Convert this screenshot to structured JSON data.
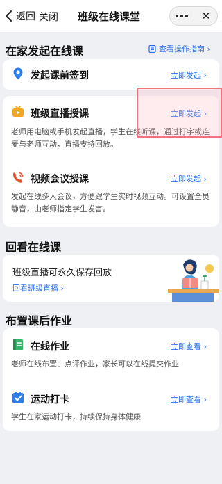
{
  "navbar": {
    "back_label": "返回",
    "close_label": "关闭",
    "title": "班级在线课堂",
    "more_icon": "more-dots-icon",
    "close_icon": "close-x-icon"
  },
  "section_start": {
    "title": "在家发起在线课",
    "guide_link": "查看操作指南 ›",
    "guide_icon": "document-icon",
    "items": [
      {
        "title": "发起课前签到",
        "action": "立即发起 ›",
        "icon": "location-pin-icon",
        "icon_color": "#2e7fe8"
      },
      {
        "title": "班级直播授课",
        "action": "立即发起 ›",
        "icon": "live-tv-icon",
        "icon_color": "#f4a623",
        "desc": "老师用电脑或手机发起直播，学生在线听课，通过打字或连麦与老师互动，直播支持回放。"
      },
      {
        "title": "视频会议授课",
        "action": "立即发起 ›",
        "icon": "video-call-icon",
        "icon_color": "#e8542e",
        "desc": "发起在线多人会议，方便跟学生实时视频互动。可设置全员静音，由老师指定学生发言。"
      }
    ]
  },
  "section_replay": {
    "title": "回看在线课",
    "text": "班级直播可永久保存回放",
    "link": "回看班级直播 ›",
    "illustration": "reading-teacher-illustration"
  },
  "section_homework": {
    "title": "布置课后作业",
    "items": [
      {
        "title": "在线作业",
        "action": "立即查看 ›",
        "icon": "notebook-icon",
        "icon_color": "#34b46a",
        "desc": "老师在线布置、点评作业，家长可以在线提交作业"
      },
      {
        "title": "运动打卡",
        "action": "立即查看 ›",
        "icon": "checkbox-icon",
        "icon_color": "#2e7fe8",
        "desc": "学生在家运动打卡，持续保持身体健康"
      }
    ]
  },
  "colors": {
    "accent": "#2c72e8",
    "background": "#eef0f3",
    "highlight": "#f0727d"
  }
}
